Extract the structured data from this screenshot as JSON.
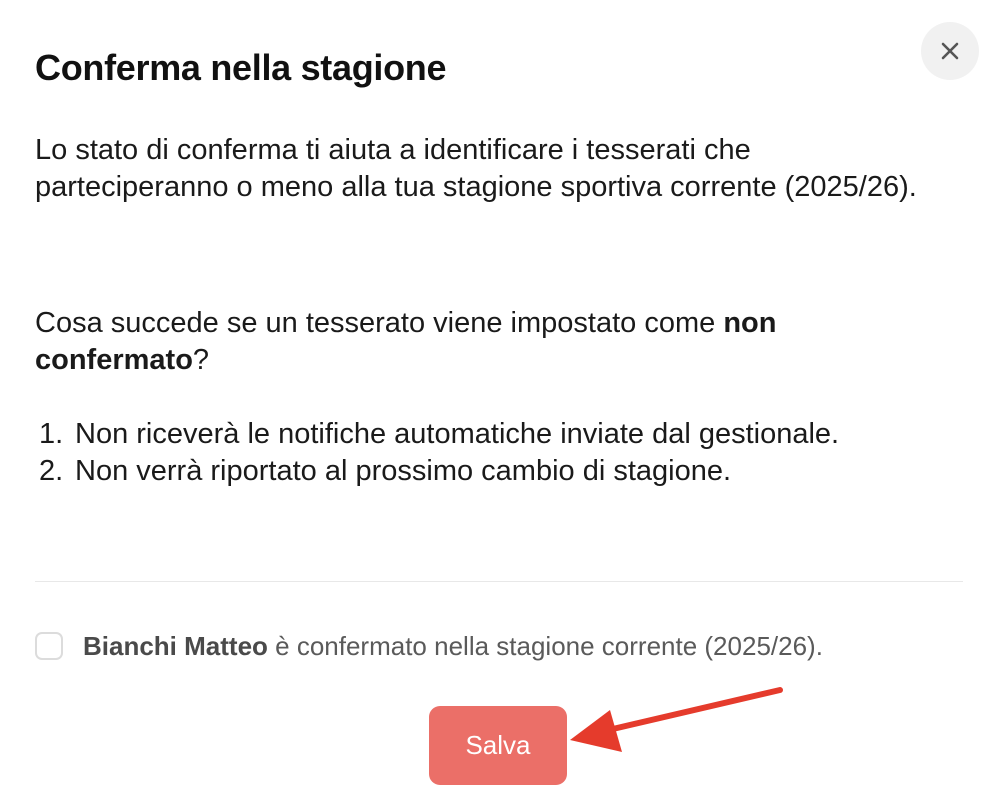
{
  "dialog": {
    "title": "Conferma nella stagione",
    "close_icon": "close-icon",
    "intro": "Lo stato di conferma ti aiuta a identificare i tesserati che parteciperanno o meno alla tua stagione sportiva corrente (2025/26).",
    "question_prefix": "Cosa succede se un tesserato viene impostato come ",
    "question_strong": "non confermato",
    "question_suffix": "?",
    "consequences": [
      {
        "num": "1.",
        "text": "Non riceverà le notifiche automatiche inviate dal gestionale."
      },
      {
        "num": "2.",
        "text": "Non verrà riportato al prossimo cambio di stagione."
      }
    ],
    "confirm": {
      "checked": false,
      "member_name": "Bianchi Matteo",
      "text": " è confermato nella stagione corrente (2025/26)."
    },
    "save_label": "Salva"
  },
  "annotation": {
    "arrow_color": "#e53b2c"
  },
  "colors": {
    "save_button": "#eb6f68",
    "close_button_bg": "#f1f1f1"
  }
}
